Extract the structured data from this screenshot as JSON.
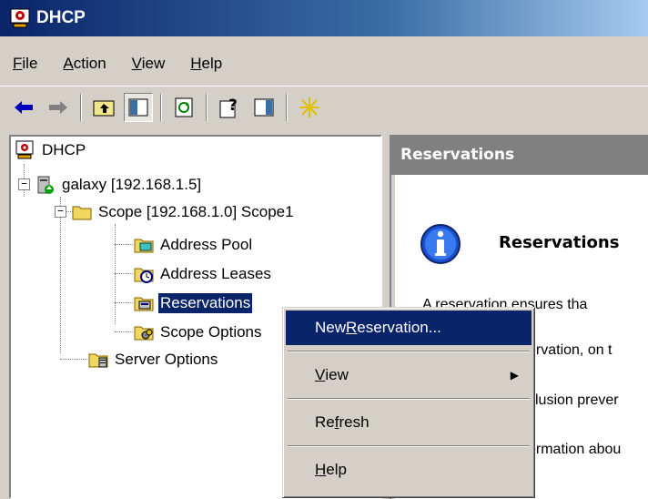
{
  "window": {
    "title": "DHCP"
  },
  "menubar": [
    {
      "label_pre": "",
      "accel": "F",
      "label_post": "ile"
    },
    {
      "label_pre": "",
      "accel": "A",
      "label_post": "ction"
    },
    {
      "label_pre": "",
      "accel": "V",
      "label_post": "iew"
    },
    {
      "label_pre": "",
      "accel": "H",
      "label_post": "elp"
    }
  ],
  "toolbar": {
    "buttons": [
      "back-icon",
      "forward-icon",
      "up-folder-icon",
      "show-hide-tree-icon",
      "refresh-icon",
      "help-icon",
      "action-pane-icon",
      "new-item-star-icon"
    ]
  },
  "tree": {
    "root": "DHCP",
    "server": "galaxy [192.168.1.5]",
    "scope": "Scope [192.168.1.0] Scope1",
    "scope_children": [
      "Address Pool",
      "Address Leases",
      "Reservations",
      "Scope Options"
    ],
    "server_options": "Server Options",
    "selected": "Reservations"
  },
  "right_pane": {
    "header": "Reservations",
    "heading": "Reservations",
    "lines": [
      "A reservation ensures tha",
      "ervation, on t",
      "clusion prever",
      "ormation abou"
    ]
  },
  "context_menu": {
    "items": [
      {
        "pre": "New ",
        "accel": "R",
        "post": "eservation...",
        "highlighted": true
      },
      {
        "pre": "",
        "accel": "V",
        "post": "iew",
        "submenu": true
      },
      {
        "pre": "Re",
        "accel": "f",
        "post": "resh"
      },
      {
        "pre": "",
        "accel": "H",
        "post": "elp"
      }
    ]
  },
  "colors": {
    "title_start": "#0a246a",
    "title_end": "#a6caf0",
    "selection": "#0a246a",
    "face": "#d4d0c8"
  }
}
